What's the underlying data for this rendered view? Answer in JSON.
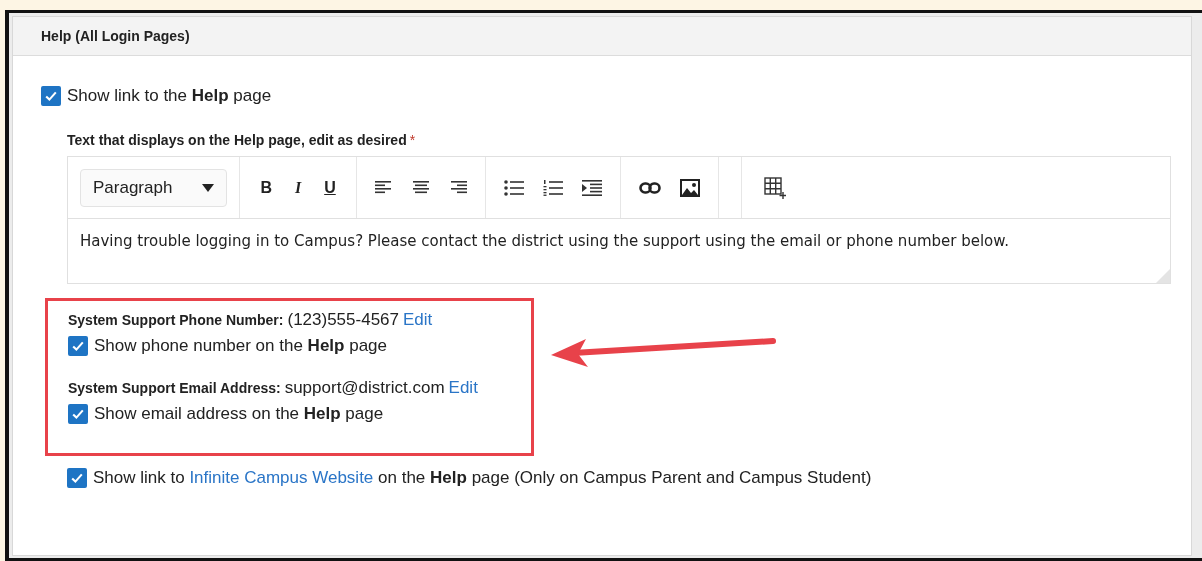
{
  "panel": {
    "title": "Help (All Login Pages)"
  },
  "show_help_link": {
    "checked": true,
    "label": "Show link to the **Help** page"
  },
  "editor": {
    "label": "Text that displays on the Help page, edit as desired",
    "required_mark": "*",
    "format_select": "Paragraph",
    "format_buttons": [
      "B",
      "I",
      "U"
    ],
    "content": "Having trouble logging in to Campus? Please contact the district using the support using the email or phone number below."
  },
  "support": [
    {
      "label": "System Support Phone Number:",
      "value": "(123)555-4567",
      "link": "Edit",
      "option": {
        "checked": true,
        "label": "Show phone number on the **Help** page"
      }
    },
    {
      "label": "System Support Email Address:",
      "value": "support@district.com",
      "link": "Edit",
      "option": {
        "checked": true,
        "label": "Show email address on the **Help** page"
      }
    }
  ],
  "website_option": {
    "checked": true,
    "before": "Show link to",
    "link": "Infinite Campus Website",
    "after": "on the **Help** page (Only on Campus Parent and Campus Student)"
  }
}
